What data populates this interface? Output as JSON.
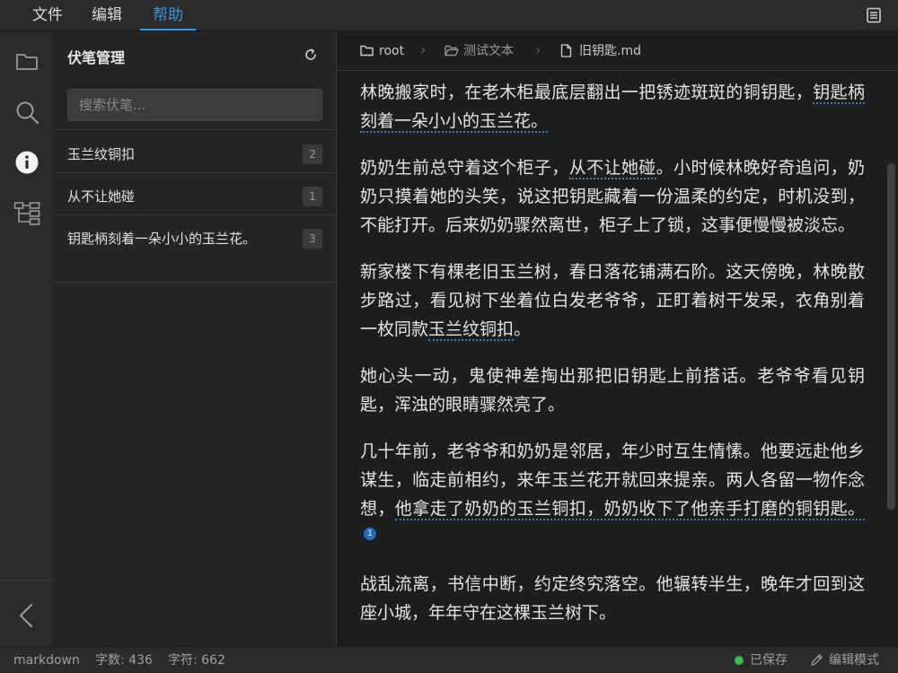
{
  "menu": {
    "file": "文件",
    "edit": "编辑",
    "help": "帮助"
  },
  "activity_bar": {
    "icons": [
      "folder-icon",
      "search-icon",
      "info-icon",
      "tree-structure-icon",
      "collapse-left-icon"
    ],
    "active": "info-icon"
  },
  "sidebar": {
    "title": "伏笔管理",
    "search_placeholder": "搜索伏笔...",
    "items": [
      {
        "label": "玉兰纹铜扣",
        "count": "2"
      },
      {
        "label": "从不让她碰",
        "count": "1"
      },
      {
        "label": "钥匙柄刻着一朵小小的玉兰花。",
        "count": "3"
      }
    ]
  },
  "breadcrumb": {
    "root": "root",
    "separator": "›",
    "folder": "测试文本",
    "file": "旧钥匙.md"
  },
  "editor": {
    "p1_a": "林晚搬家时，在老木柜最底层翻出一把锈迹斑斑的铜钥匙，",
    "p1_m": "钥匙柄刻着一朵小小的玉兰花。",
    "p2_a": "奶奶生前总守着这个柜子，",
    "p2_m": "从不让她碰",
    "p2_b": "。小时候林晚好奇追问，奶奶只摸着她的头笑，说这把钥匙藏着一份温柔的约定，时机没到，不能打开。后来奶奶骤然离世，柜子上了锁，这事便慢慢被淡忘。",
    "p3_a": "新家楼下有棵老旧玉兰树，春日落花铺满石阶。这天傍晚，林晚散步路过，看见树下坐着位白发老爷爷，正盯着树干发呆，衣角别着一枚同款",
    "p3_m": "玉兰纹铜扣",
    "p3_b": "。",
    "p4": "她心头一动，鬼使神差掏出那把旧钥匙上前搭话。老爷爷看见钥匙，浑浊的眼睛骤然亮了。",
    "p5_a": "几十年前，老爷爷和奶奶是邻居，年少时互生情愫。他要远赴他乡谋生，临走前相约，来年玉兰花开就回来提亲。两人各留一物作念想，",
    "p5_m": "他拿走了奶奶的玉兰铜扣，奶奶收下了他亲手打磨的铜钥匙。",
    "p5_fn": "1",
    "p6": "战乱流离，书信中断，约定终究落空。他辗转半生，晚年才回到这座小城，年年守在这棵玉兰树下。"
  },
  "status": {
    "language": "markdown",
    "words": "字数: 436",
    "chars": "字符: 662",
    "saved": "已保存",
    "mode": "编辑模式"
  },
  "colors": {
    "accent": "#3c95d8",
    "saved_dot": "#3fb950",
    "foreshadow_underline": "#3b7fc4"
  }
}
